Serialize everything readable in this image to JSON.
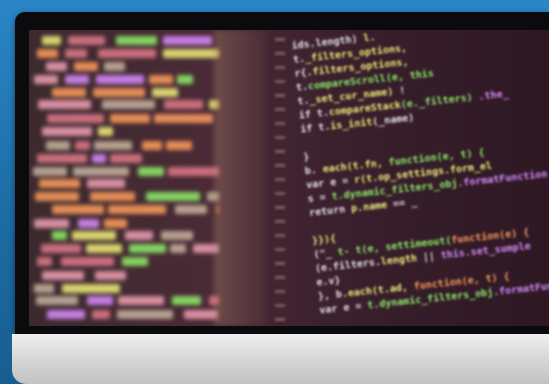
{
  "scene": {
    "description_label": "",
    "colors": {
      "background": "#1f6fa8",
      "bezel": "#0b0b0d",
      "stand": "#d4d4d4",
      "syntax_yellow": "#f2f07a",
      "syntax_green": "#8ef06a",
      "syntax_purple": "#d98cff",
      "syntax_orange": "#ff9d5c",
      "syntax_white": "#e9e6ee"
    }
  }
}
